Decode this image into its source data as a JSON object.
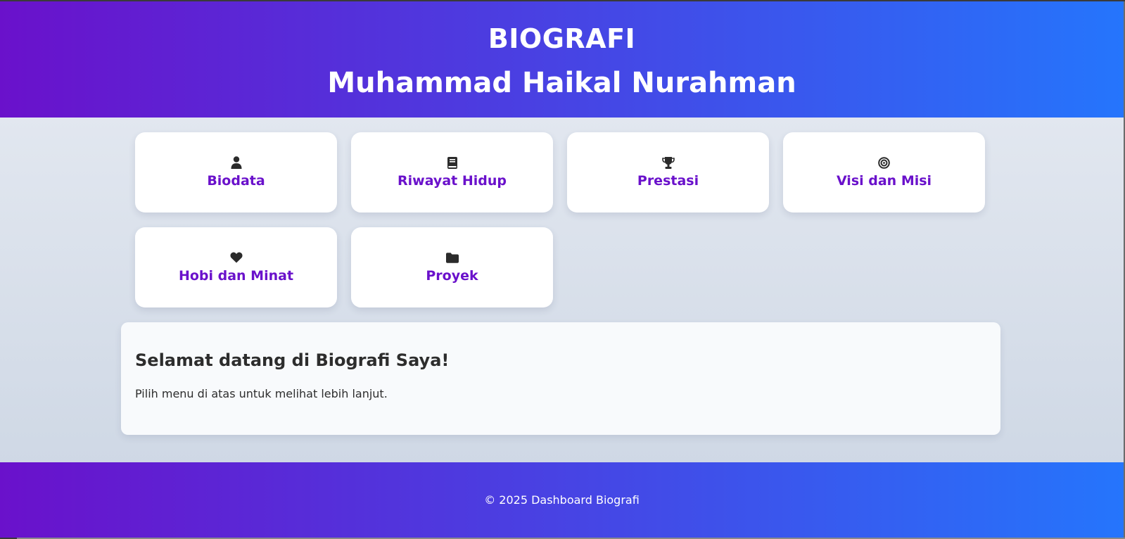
{
  "header": {
    "title": "BIOGRAFI",
    "name": "Muhammad Haikal Nurahman"
  },
  "menu": [
    {
      "label": "Biodata",
      "icon": "user-icon"
    },
    {
      "label": "Riwayat Hidup",
      "icon": "book-icon"
    },
    {
      "label": "Prestasi",
      "icon": "trophy-icon"
    },
    {
      "label": "Visi dan Misi",
      "icon": "target-icon"
    },
    {
      "label": "Hobi dan Minat",
      "icon": "heart-icon"
    },
    {
      "label": "Proyek",
      "icon": "folder-icon"
    }
  ],
  "welcome": {
    "heading": "Selamat datang di Biografi Saya!",
    "text": "Pilih menu di atas untuk melihat lebih lanjut."
  },
  "footer": {
    "text": "© 2025 Dashboard Biografi"
  },
  "colors": {
    "gradient_start": "#6a11cb",
    "gradient_end": "#2575fc",
    "menu_label": "#6a11cb"
  }
}
